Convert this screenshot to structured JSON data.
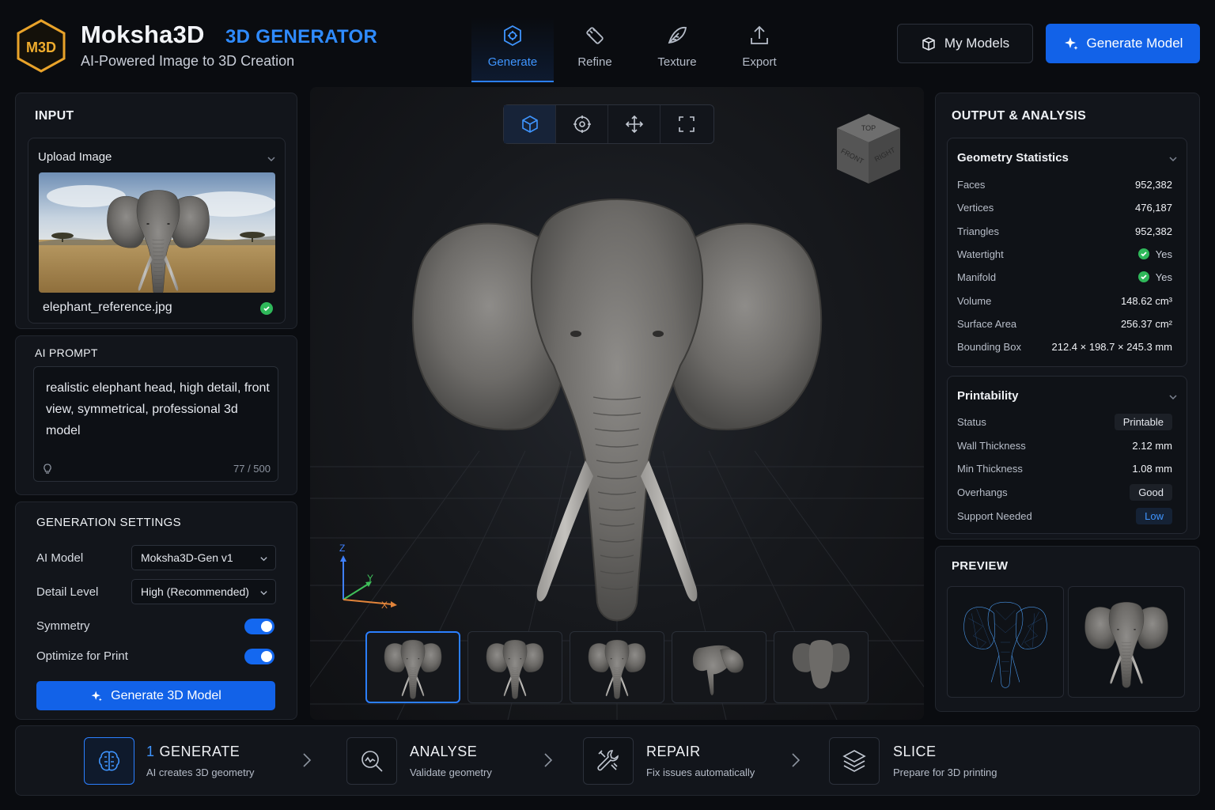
{
  "header": {
    "brand": "Moksha3D",
    "brand_sub": "3D GENERATOR",
    "tagline": "AI-Powered Image to 3D Creation",
    "logo_text": "M3D",
    "tabs": [
      {
        "label": "Generate",
        "icon": "generate-icon",
        "active": true
      },
      {
        "label": "Refine",
        "icon": "refine-icon",
        "active": false
      },
      {
        "label": "Texture",
        "icon": "texture-icon",
        "active": false
      },
      {
        "label": "Export",
        "icon": "export-icon",
        "active": false
      }
    ],
    "my_models_label": "My Models",
    "generate_model_label": "Generate Model",
    "accent": "#1262e8"
  },
  "input": {
    "title": "INPUT",
    "upload_label": "Upload Image",
    "file_name": "elephant_reference.jpg"
  },
  "prompt": {
    "title": "AI PROMPT",
    "text": "realistic elephant head, high detail, front view, symmetrical, professional 3d model",
    "count": "77 / 500"
  },
  "settings": {
    "title": "GENERATION SETTINGS",
    "ai_model_label": "AI Model",
    "ai_model_value": "Moksha3D-Gen v1",
    "detail_label": "Detail Level",
    "detail_value": "High (Recommended)",
    "symmetry_label": "Symmetry",
    "symmetry_on": true,
    "optimize_label": "Optimize for Print",
    "optimize_on": true,
    "generate_label": "Generate 3D Model"
  },
  "viewport": {
    "tools": [
      "cube-icon",
      "target-icon",
      "move-icon",
      "fullscreen-icon"
    ],
    "cube_top": "TOP",
    "cube_front": "FRONT",
    "cube_right": "RIGHT",
    "axis_x": "X",
    "axis_y": "Y",
    "axis_z": "Z"
  },
  "output": {
    "title": "OUTPUT & ANALYSIS",
    "geometry": {
      "title": "Geometry Statistics",
      "rows": [
        {
          "key": "Faces",
          "value": "952,382"
        },
        {
          "key": "Vertices",
          "value": "476,187"
        },
        {
          "key": "Triangles",
          "value": "952,382"
        },
        {
          "key": "Watertight",
          "value": "Yes"
        },
        {
          "key": "Manifold",
          "value": "Yes"
        },
        {
          "key": "Volume",
          "value": "148.62 cm³"
        },
        {
          "key": "Surface Area",
          "value": "256.37 cm²"
        },
        {
          "key": "Bounding Box",
          "value": "212.4 × 198.7 × 245.3 mm"
        }
      ]
    },
    "printability": {
      "title": "Printability",
      "rows": [
        {
          "key": "Status",
          "value": "Printable"
        },
        {
          "key": "Wall Thickness",
          "value": "2.12 mm"
        },
        {
          "key": "Min Thickness",
          "value": "1.08 mm"
        },
        {
          "key": "Overhangs",
          "value": "Good"
        },
        {
          "key": "Support Needed",
          "value": "Low"
        }
      ]
    },
    "preview_title": "PREVIEW"
  },
  "workflow": [
    {
      "num": "1",
      "title": "GENERATE",
      "desc": "AI creates 3D geometry",
      "icon": "brain-icon"
    },
    {
      "title": "ANALYSE",
      "desc": "Validate geometry",
      "icon": "analyse-icon"
    },
    {
      "title": "REPAIR",
      "desc": "Fix issues automatically",
      "icon": "repair-icon"
    },
    {
      "title": "SLICE",
      "desc": "Prepare for 3D printing",
      "icon": "layers-icon"
    }
  ],
  "colors": {
    "accent": "#1262e8",
    "accent_text": "#3f95ff",
    "success": "#2fb85a",
    "panel": "#12151b"
  }
}
